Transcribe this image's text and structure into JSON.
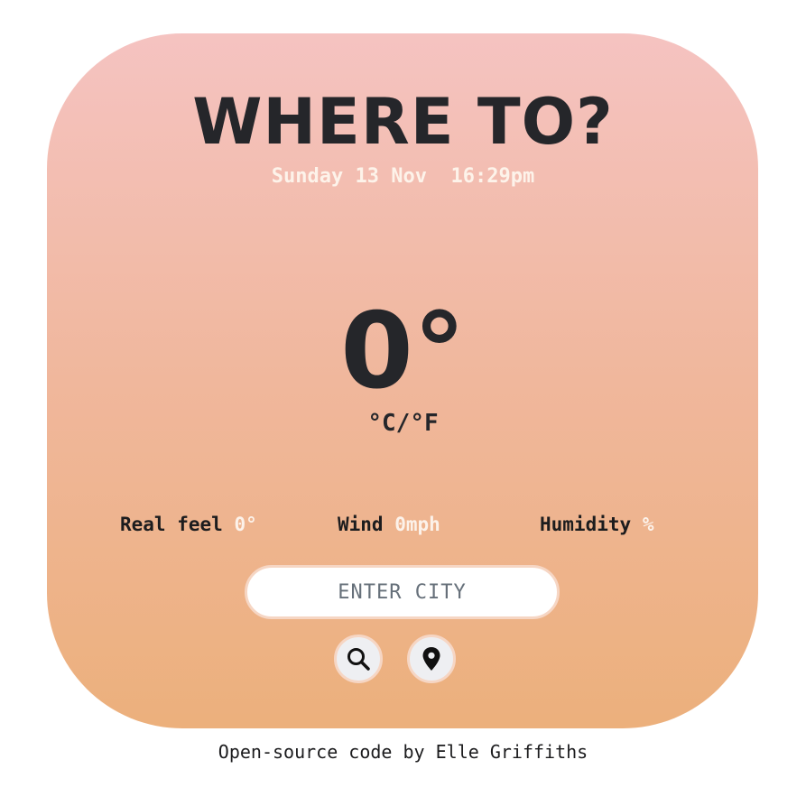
{
  "header": {
    "title": "WHERE TO?",
    "date": "Sunday 13 Nov",
    "time": "16:29pm"
  },
  "current": {
    "temperature": "0°",
    "unit_toggle": "°C/°F"
  },
  "stats": {
    "real_feel_label": "Real feel",
    "real_feel_value": "0°",
    "wind_label": "Wind",
    "wind_value": "0mph",
    "humidity_label": "Humidity",
    "humidity_value": "%"
  },
  "search": {
    "placeholder": "ENTER CITY",
    "value": ""
  },
  "buttons": {
    "search_icon": "search-icon",
    "location_icon": "location-pin-icon"
  },
  "footer": {
    "text": "Open-source code by Elle Griffiths"
  },
  "colors": {
    "gradient_top": "#f5c3c1",
    "gradient_bottom": "#ecb07c",
    "accent_text": "#fcf2ea",
    "dark_text": "#25262a"
  }
}
